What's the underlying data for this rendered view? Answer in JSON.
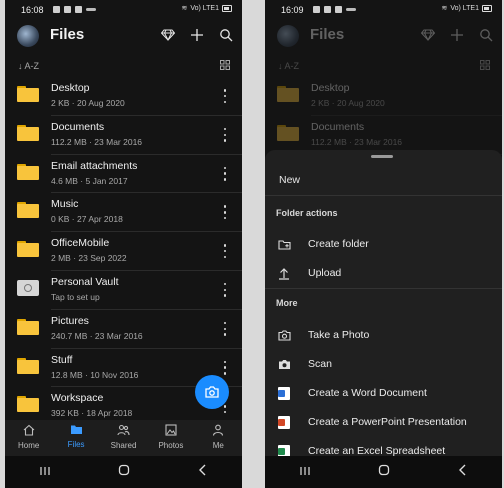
{
  "left": {
    "status": {
      "time": "16:08",
      "signal_text": "Vo) LTE1"
    },
    "appbar": {
      "title": "Files"
    },
    "sort_label": "↓ A-Z",
    "files": [
      {
        "name": "Desktop",
        "meta": "2 KB · 20 Aug 2020",
        "icon": "folder-icon"
      },
      {
        "name": "Documents",
        "meta": "112.2 MB · 23 Mar 2016",
        "icon": "folder-icon"
      },
      {
        "name": "Email attachments",
        "meta": "4.6 MB · 5 Jan 2017",
        "icon": "folder-icon"
      },
      {
        "name": "Music",
        "meta": "0 KB · 27 Apr 2018",
        "icon": "folder-icon"
      },
      {
        "name": "OfficeMobile",
        "meta": "2 MB · 23 Sep 2022",
        "icon": "folder-icon"
      },
      {
        "name": "Personal Vault",
        "meta": "Tap to set up",
        "icon": "vault-icon"
      },
      {
        "name": "Pictures",
        "meta": "240.7 MB · 23 Mar 2016",
        "icon": "folder-icon"
      },
      {
        "name": "Stuff",
        "meta": "12.8 MB · 10 Nov 2016",
        "icon": "folder-icon"
      },
      {
        "name": "Workspace",
        "meta": "392 KB · 18 Apr 2018",
        "icon": "folder-icon"
      }
    ],
    "nav": [
      {
        "label": "Home",
        "icon": "home-icon"
      },
      {
        "label": "Files",
        "icon": "folder-icon",
        "active": true
      },
      {
        "label": "Shared",
        "icon": "people-icon"
      },
      {
        "label": "Photos",
        "icon": "photo-icon"
      },
      {
        "label": "Me",
        "icon": "person-icon"
      }
    ]
  },
  "right": {
    "status": {
      "time": "16:09",
      "signal_text": "Vo) LTE1"
    },
    "appbar": {
      "title": "Files"
    },
    "sort_label": "↓ A-Z",
    "files": [
      {
        "name": "Desktop",
        "meta": "2 KB · 20 Aug 2020"
      },
      {
        "name": "Documents",
        "meta": "112.2 MB · 23 Mar 2016"
      }
    ],
    "sheet": {
      "new_label": "New",
      "folder_actions_title": "Folder actions",
      "create_folder": "Create folder",
      "upload": "Upload",
      "more_title": "More",
      "take_photo": "Take a Photo",
      "scan": "Scan",
      "word": "Create a Word Document",
      "powerpoint": "Create a PowerPoint Presentation",
      "excel": "Create an Excel Spreadsheet"
    }
  },
  "colors": {
    "accent": "#1a8cff",
    "folder": "#f8c43c",
    "background": "#141414",
    "sheet": "#202020"
  }
}
